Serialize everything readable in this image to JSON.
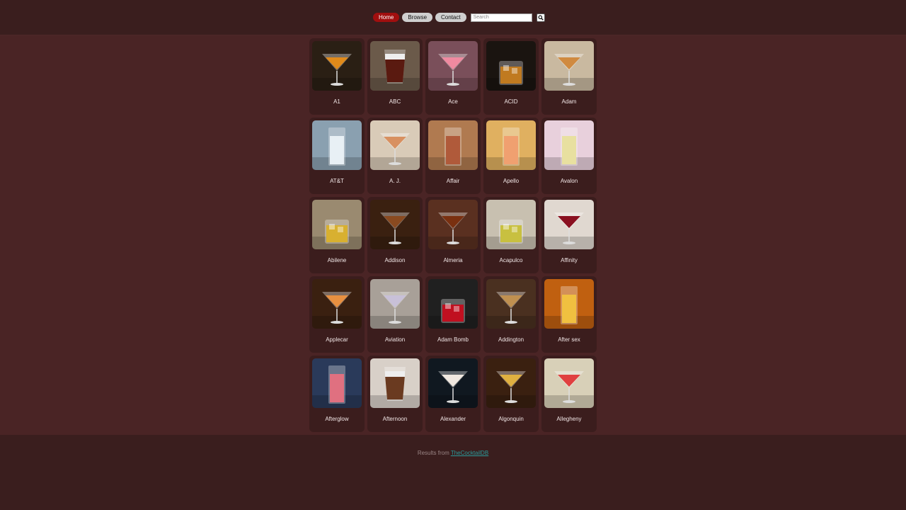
{
  "nav": {
    "home_label": "Home",
    "browse_label": "Browse",
    "contact_label": "Contact",
    "search_placeholder": "Search",
    "active_color": "#a10f0f"
  },
  "cocktails": [
    {
      "name": "A1",
      "bg": "#2a1f14",
      "drink": "#e08a1a",
      "glass": "martini"
    },
    {
      "name": "ABC",
      "bg": "#6b5a4a",
      "drink": "#5a1a10",
      "glass": "shot"
    },
    {
      "name": "Ace",
      "bg": "#7a4f5a",
      "drink": "#f08aa0",
      "glass": "martini"
    },
    {
      "name": "ACID",
      "bg": "#1a1410",
      "drink": "#c07a20",
      "glass": "rocks"
    },
    {
      "name": "Adam",
      "bg": "#c9b9a0",
      "drink": "#d08a40",
      "glass": "martini"
    },
    {
      "name": "AT&T",
      "bg": "#8aa0b0",
      "drink": "#e8f0f5",
      "glass": "highball"
    },
    {
      "name": "A. J.",
      "bg": "#d9cbb8",
      "drink": "#d89060",
      "glass": "martini"
    },
    {
      "name": "Affair",
      "bg": "#b07a50",
      "drink": "#b05a3a",
      "glass": "highball"
    },
    {
      "name": "Apello",
      "bg": "#e0b060",
      "drink": "#f0a070",
      "glass": "highball"
    },
    {
      "name": "Avalon",
      "bg": "#e8d0dc",
      "drink": "#e8e0a0",
      "glass": "highball"
    },
    {
      "name": "Abilene",
      "bg": "#9a8a70",
      "drink": "#d8b030",
      "glass": "rocks"
    },
    {
      "name": "Addison",
      "bg": "#3a2010",
      "drink": "#8a4a20",
      "glass": "martini"
    },
    {
      "name": "Almeria",
      "bg": "#5a3020",
      "drink": "#7a3010",
      "glass": "martini"
    },
    {
      "name": "Acapulco",
      "bg": "#c8c0b0",
      "drink": "#c8c040",
      "glass": "rocks"
    },
    {
      "name": "Affinity",
      "bg": "#e0d8d0",
      "drink": "#8a1020",
      "glass": "martini"
    },
    {
      "name": "Applecar",
      "bg": "#3a2010",
      "drink": "#e89040",
      "glass": "martini"
    },
    {
      "name": "Aviation",
      "bg": "#a8a098",
      "drink": "#c8c0d8",
      "glass": "martini"
    },
    {
      "name": "Adam Bomb",
      "bg": "#202020",
      "drink": "#c01020",
      "glass": "rocks"
    },
    {
      "name": "Addington",
      "bg": "#4a3020",
      "drink": "#c09050",
      "glass": "martini"
    },
    {
      "name": "After sex",
      "bg": "#c06010",
      "drink": "#f0c040",
      "glass": "highball"
    },
    {
      "name": "Afterglow",
      "bg": "#2a3a5a",
      "drink": "#e07080",
      "glass": "highball"
    },
    {
      "name": "Afternoon",
      "bg": "#d8d0c8",
      "drink": "#6a3a20",
      "glass": "shot"
    },
    {
      "name": "Alexander",
      "bg": "#101820",
      "drink": "#f0e8e0",
      "glass": "martini"
    },
    {
      "name": "Algonquin",
      "bg": "#3a2010",
      "drink": "#e0b040",
      "glass": "martini"
    },
    {
      "name": "Allegheny",
      "bg": "#d8d0b8",
      "drink": "#e04040",
      "glass": "martini"
    }
  ],
  "footer": {
    "prefix": "Results from",
    "link_text": "TheCocktailDB"
  }
}
